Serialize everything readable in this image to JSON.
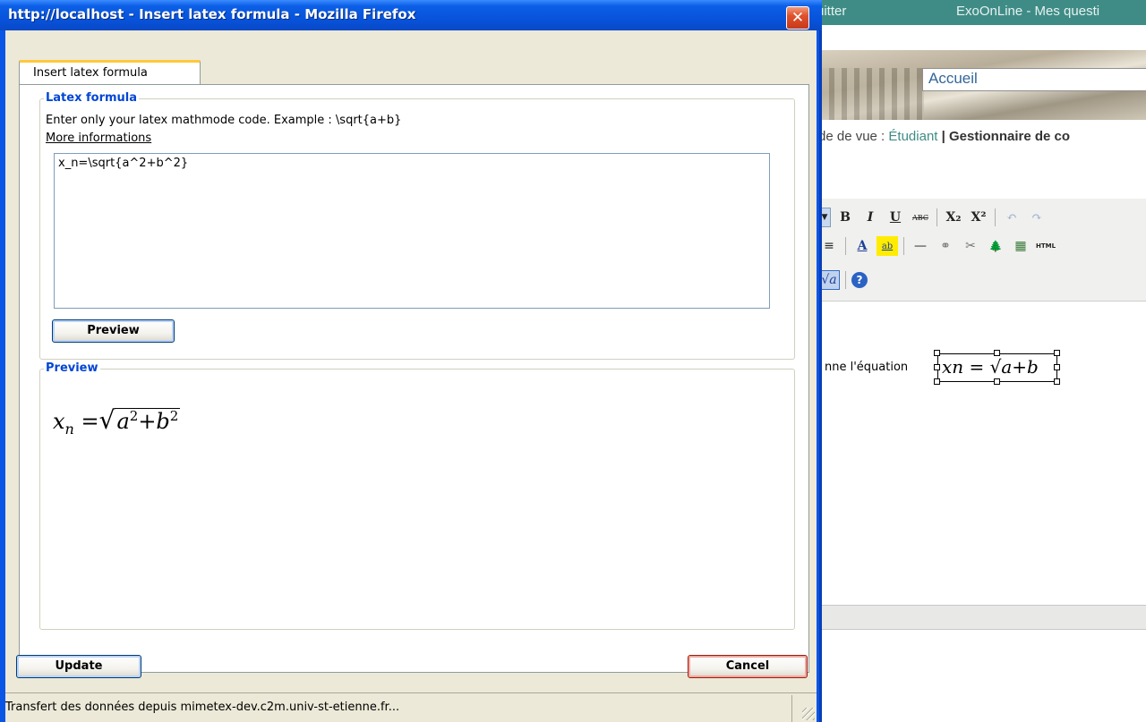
{
  "window": {
    "title": "http://localhost - Insert latex formula - Mozilla Firefox",
    "close_glyph": "✕"
  },
  "tabs": [
    {
      "label": "Insert latex formula",
      "active": true
    }
  ],
  "latex_group": {
    "legend": "Latex formula",
    "instruction": "Enter only your latex mathmode code. Example : \\sqrt{a+b}",
    "more_link": "More informations",
    "formula_value": "x_n=\\sqrt{a^2+b^2}",
    "preview_button": "Preview"
  },
  "preview_group": {
    "legend": "Preview",
    "formula": {
      "base": "x",
      "subscript": "n",
      "equals": "=",
      "sqrt": "√",
      "a": "a",
      "a_exp": "2",
      "plus": "+",
      "b": "b",
      "b_exp": "2"
    }
  },
  "buttons": {
    "update": "Update",
    "cancel": "Cancel"
  },
  "status": {
    "text": "Transfert des données depuis mimetex-dev.c2m.univ-st-etienne.fr..."
  },
  "background": {
    "quit_fragment": "uitter",
    "site_title": "ExoOnLine - Mes questi",
    "search_value": "Accueil",
    "viewpoint_prefix": "de de vue : ",
    "viewpoint_link": "Étudiant",
    "viewpoint_sep": " | ",
    "viewpoint_bold": "Gestionnaire de co",
    "editor_text": "nne l'équation",
    "editor_equation": "xn = √a+b",
    "toolbar_row1": [
      "B",
      "I",
      "U",
      "ABC",
      "X₂",
      "X²",
      "↶",
      "↷"
    ],
    "toolbar_row2": [
      "≡",
      "A",
      "ab",
      "—",
      "⚭",
      "✂",
      "🌲",
      "▦",
      "HTML"
    ],
    "toolbar_row3": [
      "√a",
      "?"
    ]
  },
  "colors": {
    "titlebar": "#0751d8",
    "legend": "#0046d5",
    "teal_bar": "#3f8c86",
    "close": "#e0512c"
  }
}
